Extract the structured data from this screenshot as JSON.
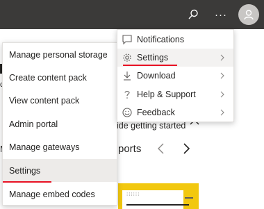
{
  "topbar": {
    "search_icon": "search-icon",
    "more_label": "···",
    "avatar_icon": "person-icon"
  },
  "background": {
    "getting_started_text": "ide getting started",
    "reports_text": "ports",
    "left_fragment_c": "c",
    "left_fragment_m": "M"
  },
  "left_menu": {
    "items": [
      {
        "label": "Manage personal storage"
      },
      {
        "label": "Create content pack"
      },
      {
        "label": "View content pack"
      },
      {
        "label": "Admin portal"
      },
      {
        "label": "Manage gateways"
      },
      {
        "label": "Settings"
      },
      {
        "label": "Manage embed codes"
      }
    ],
    "selected_index": 5
  },
  "right_menu": {
    "items": [
      {
        "label": "Notifications",
        "icon": "notification-icon",
        "has_submenu": false
      },
      {
        "label": "Settings",
        "icon": "gear-icon",
        "has_submenu": true
      },
      {
        "label": "Download",
        "icon": "download-icon",
        "has_submenu": true
      },
      {
        "label": "Help & Support",
        "icon": "question-icon",
        "has_submenu": true
      },
      {
        "label": "Feedback",
        "icon": "smiley-icon",
        "has_submenu": true
      }
    ],
    "selected_index": 1
  },
  "tile": {
    "dots": "⁝⁝⁝⁝⁝⁝"
  },
  "colors": {
    "topbar": "#3b3a39",
    "highlight_underline": "#e81123",
    "tile_accent": "#f2c80f"
  }
}
